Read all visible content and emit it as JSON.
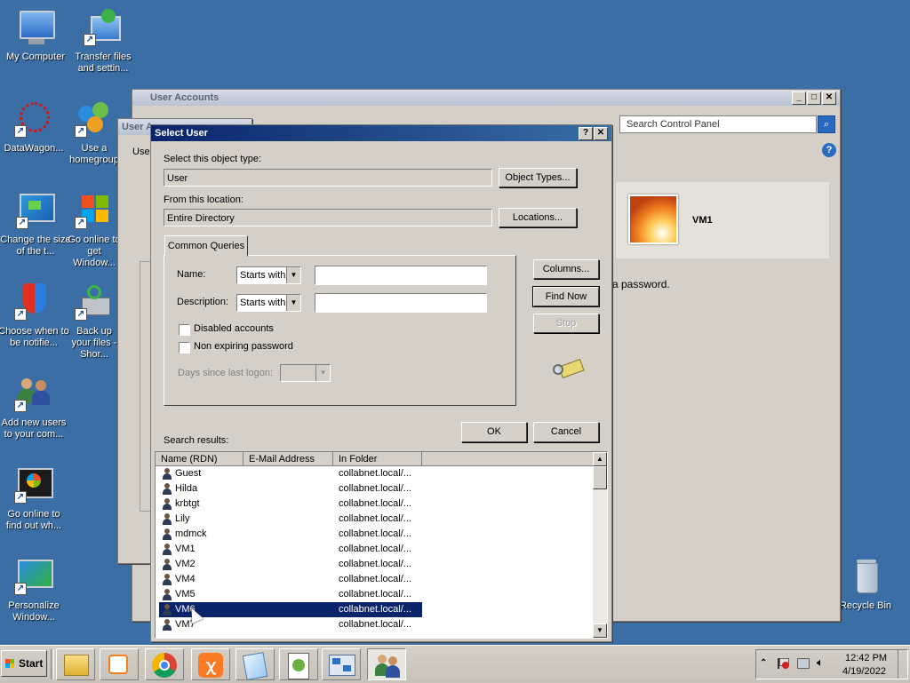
{
  "desktop": {
    "icons": [
      {
        "label": "My Computer",
        "icon": "computer-icon"
      },
      {
        "label": "Transfer files and settin...",
        "icon": "transfer-icon"
      },
      {
        "label": "DataWagon...",
        "icon": "datawagon-icon"
      },
      {
        "label": "Use a homegroup",
        "icon": "homegroup-icon"
      },
      {
        "label": "Change the size of the t...",
        "icon": "display-icon"
      },
      {
        "label": "Go online to get Window...",
        "icon": "windows-icon"
      },
      {
        "label": "Choose when to be notifie...",
        "icon": "shield-icon"
      },
      {
        "label": "Back up your files - Shor...",
        "icon": "backup-icon"
      },
      {
        "label": "Add new users to your com...",
        "icon": "users-icon"
      },
      {
        "label": "Go online to find out wh...",
        "icon": "windows-online-icon"
      },
      {
        "label": "Personalize Window...",
        "icon": "personalize-icon"
      },
      {
        "label": "Recycle Bin",
        "icon": "recycle-bin-icon"
      }
    ]
  },
  "user_accounts_window": {
    "title": "User Accounts",
    "search_placeholder": "Search Control Panel",
    "account_name": "VM1",
    "password_text": "a password."
  },
  "behind_window": {
    "title": "User A",
    "fragment": "Use"
  },
  "dialog": {
    "title": "Select User",
    "help_btn": "?",
    "close_btn": "✕",
    "object_type_label": "Select this object type:",
    "object_type_value": "User",
    "object_types_btn": "Object Types...",
    "location_label": "From this location:",
    "location_value": "Entire Directory",
    "locations_btn": "Locations...",
    "tab_common_queries": "Common Queries",
    "name_label": "Name:",
    "name_mode": "Starts with",
    "description_label": "Description:",
    "description_mode": "Starts with",
    "disabled_accounts": "Disabled accounts",
    "non_expiring_password": "Non expiring password",
    "days_since_logon": "Days since last logon:",
    "columns_btn": "Columns...",
    "find_now_btn": "Find Now",
    "stop_btn": "Stop",
    "ok_btn": "OK",
    "cancel_btn": "Cancel",
    "search_results_label": "Search results:",
    "columns": [
      "Name (RDN)",
      "E-Mail Address",
      "In Folder"
    ],
    "results": [
      {
        "name": "Guest",
        "folder": "collabnet.local/..."
      },
      {
        "name": "Hilda",
        "folder": "collabnet.local/..."
      },
      {
        "name": "krbtgt",
        "folder": "collabnet.local/..."
      },
      {
        "name": "Lily",
        "folder": "collabnet.local/..."
      },
      {
        "name": "mdmck",
        "folder": "collabnet.local/..."
      },
      {
        "name": "VM1",
        "folder": "collabnet.local/..."
      },
      {
        "name": "VM2",
        "folder": "collabnet.local/..."
      },
      {
        "name": "VM4",
        "folder": "collabnet.local/..."
      },
      {
        "name": "VM5",
        "folder": "collabnet.local/..."
      },
      {
        "name": "VM6",
        "folder": "collabnet.local/..."
      },
      {
        "name": "VM7",
        "folder": "collabnet.local/..."
      }
    ],
    "selected_index": 9
  },
  "taskbar": {
    "start_label": "Start",
    "items": [
      "explorer-icon",
      "media-icon",
      "chrome-icon",
      "xampp-icon",
      "notepad-icon",
      "notepadpp-icon",
      "network-icon",
      "users-taskbar-icon"
    ],
    "clock_time": "12:42 PM",
    "clock_date": "4/19/2022"
  },
  "colors": {
    "desktop": "#3a6ea5",
    "dialog_title": "#0a246a",
    "selection": "#0a246a"
  }
}
